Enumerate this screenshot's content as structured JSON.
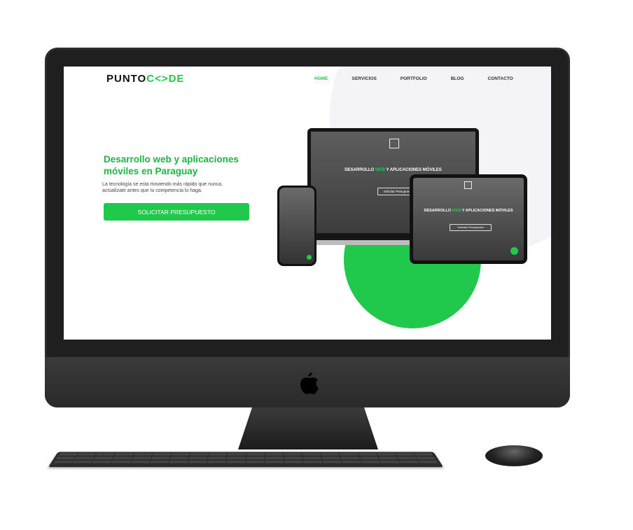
{
  "site": {
    "logo_left": "PUNTO",
    "logo_mid": "C<>DE",
    "nav": [
      "HOME",
      "SERVICIOS",
      "PORTFOLIO",
      "BLOG",
      "CONTACTO"
    ],
    "hero_title": "Desarrollo web y aplicaciones móviles en Paraguay",
    "hero_desc": "La tecnología se esta moviendo más rápido que nunca, actualízate antes que tu competencia lo haga.",
    "cta_label": "SOLICITAR PRESUPUESTO"
  },
  "mockups": {
    "title_pre": "DESARROLLO",
    "title_hl": "WEB",
    "title_post": "Y APLICACIONES MÓVILES",
    "button_label": "Solicitar Presupuesto"
  },
  "colors": {
    "accent": "#20c84b",
    "imac_frame": "#1f1f1f"
  },
  "icons": [
    "apple-logo-icon",
    "whatsapp-icon"
  ]
}
